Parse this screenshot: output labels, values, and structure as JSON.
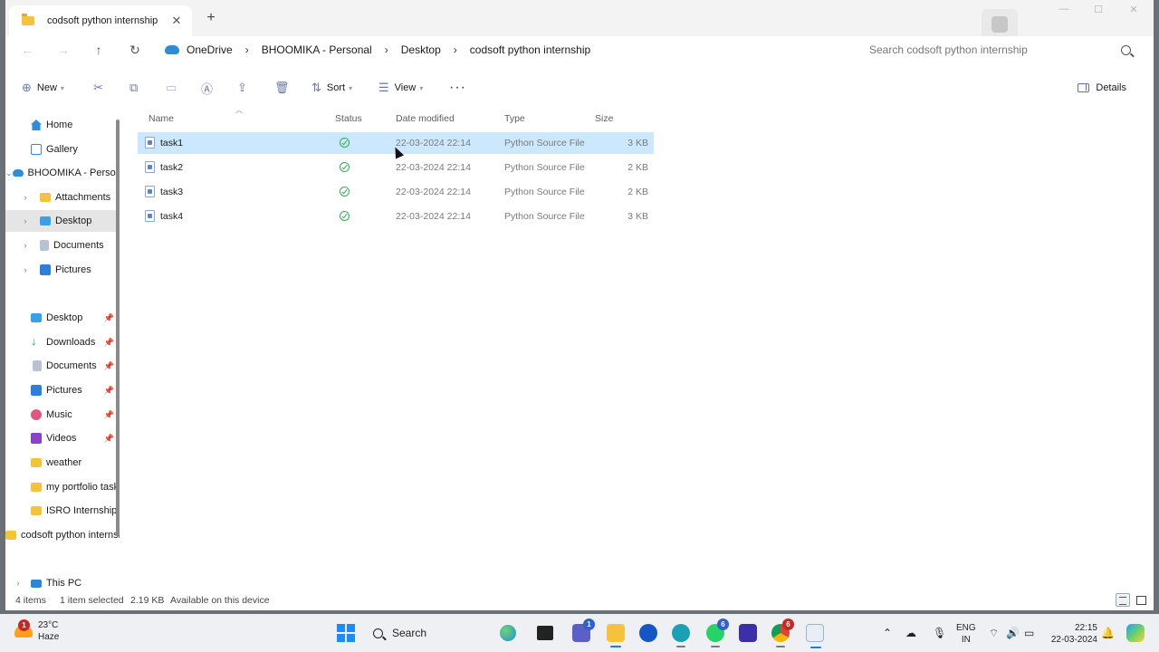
{
  "window": {
    "tab_title": "codsoft python internship",
    "tab_close": "✕",
    "new_tab": "+",
    "controls": {
      "minimize": "—",
      "maximize": "☐",
      "close": "✕"
    }
  },
  "address": {
    "crumbs": [
      "OneDrive",
      "BHOOMIKA - Personal",
      "Desktop",
      "codsoft python internship"
    ],
    "separator": "›",
    "search_placeholder": "Search codsoft python internship"
  },
  "toolbar": {
    "new_label": "New",
    "sort_label": "Sort",
    "view_label": "View",
    "more_label": "···",
    "details_label": "Details"
  },
  "sidebar": {
    "items": [
      {
        "label": "Home"
      },
      {
        "label": "Gallery"
      },
      {
        "label": "BHOOMIKA - Personal"
      },
      {
        "label": "Attachments"
      },
      {
        "label": "Desktop"
      },
      {
        "label": "Documents"
      },
      {
        "label": "Pictures"
      },
      {
        "label": "Desktop"
      },
      {
        "label": "Downloads"
      },
      {
        "label": "Documents"
      },
      {
        "label": "Pictures"
      },
      {
        "label": "Music"
      },
      {
        "label": "Videos"
      },
      {
        "label": "weather"
      },
      {
        "label": "my portfolio task"
      },
      {
        "label": "ISRO Internship"
      },
      {
        "label": "codsoft python internship"
      },
      {
        "label": "This PC"
      }
    ],
    "pin": "📌"
  },
  "files": {
    "columns": {
      "name": "Name",
      "status": "Status",
      "date": "Date modified",
      "type": "Type",
      "size": "Size"
    },
    "rows": [
      {
        "name": "task1",
        "date": "22-03-2024 22:14",
        "type": "Python Source File",
        "size": "3 KB"
      },
      {
        "name": "task2",
        "date": "22-03-2024 22:14",
        "type": "Python Source File",
        "size": "2 KB"
      },
      {
        "name": "task3",
        "date": "22-03-2024 22:14",
        "type": "Python Source File",
        "size": "2 KB"
      },
      {
        "name": "task4",
        "date": "22-03-2024 22:14",
        "type": "Python Source File",
        "size": "3 KB"
      }
    ]
  },
  "status": {
    "count": "4 items",
    "selection": "1 item selected",
    "size": "2.19 KB",
    "availability": "Available on this device"
  },
  "taskbar": {
    "weather_badge": "1",
    "temp": "23°C",
    "condition": "Haze",
    "search_label": "Search",
    "teams_badge": "1",
    "whatsapp_badge": "6",
    "chrome_badge": "6",
    "lang_1": "ENG",
    "lang_2": "IN",
    "time": "22:15",
    "date": "22-03-2024"
  }
}
